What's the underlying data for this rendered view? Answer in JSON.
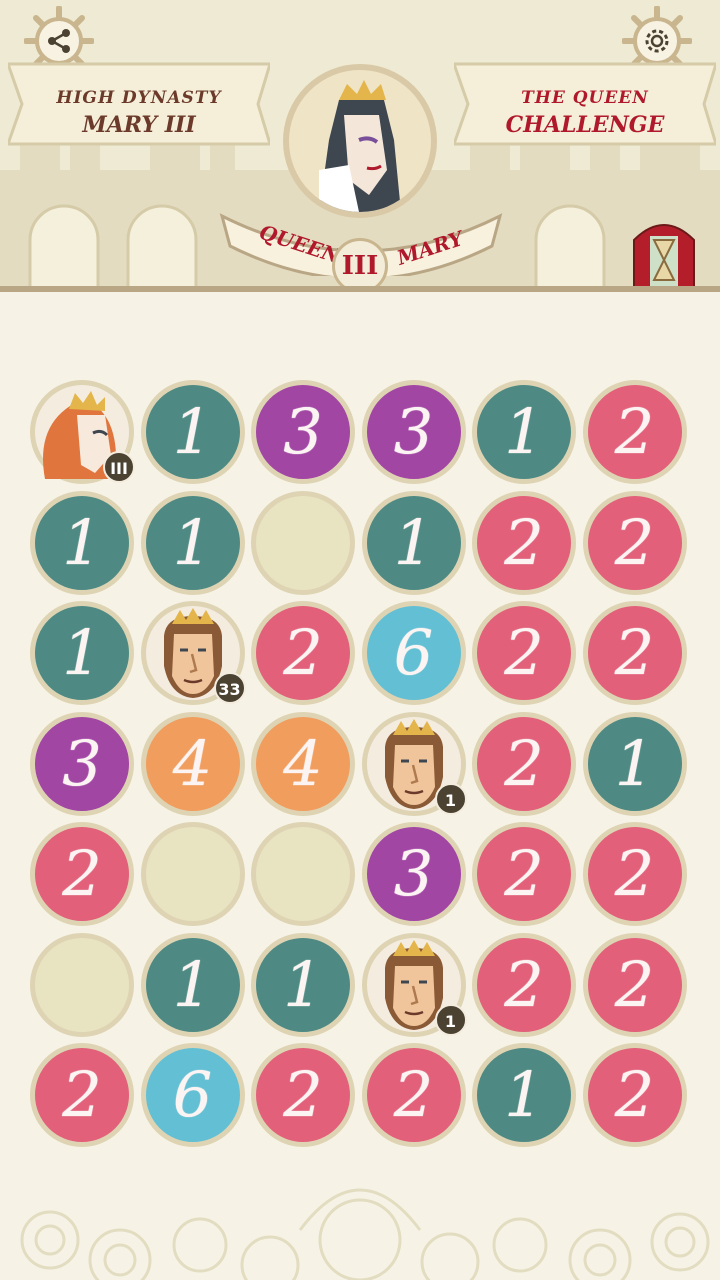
{
  "header": {
    "left_banner": {
      "line1": "HIGH DYNASTY",
      "line2": "MARY III"
    },
    "right_banner": {
      "line1": "THE QUEEN",
      "line2": "CHALLENGE"
    },
    "ribbon": {
      "left": "QUEEN",
      "right": "MARY"
    },
    "medal": "III",
    "share_icon": "share-icon",
    "settings_icon": "gear-icon",
    "timer_icon": "hourglass-icon"
  },
  "colors": {
    "1": "#4e8a83",
    "2": "#e2607a",
    "3": "#a246a4",
    "4": "#f19d5e",
    "6": "#63bfd3",
    "empty": "#e8e3c1"
  },
  "board": {
    "rows": [
      [
        {
          "type": "queen",
          "badge": "III"
        },
        {
          "type": "num",
          "value": "1"
        },
        {
          "type": "num",
          "value": "3"
        },
        {
          "type": "num",
          "value": "3"
        },
        {
          "type": "num",
          "value": "1"
        },
        {
          "type": "num",
          "value": "2"
        }
      ],
      [
        {
          "type": "num",
          "value": "1"
        },
        {
          "type": "num",
          "value": "1"
        },
        {
          "type": "empty"
        },
        {
          "type": "num",
          "value": "1"
        },
        {
          "type": "num",
          "value": "2"
        },
        {
          "type": "num",
          "value": "2"
        }
      ],
      [
        {
          "type": "num",
          "value": "1"
        },
        {
          "type": "king",
          "badge": "33"
        },
        {
          "type": "num",
          "value": "2"
        },
        {
          "type": "num",
          "value": "6"
        },
        {
          "type": "num",
          "value": "2"
        },
        {
          "type": "num",
          "value": "2"
        }
      ],
      [
        {
          "type": "num",
          "value": "3"
        },
        {
          "type": "num",
          "value": "4"
        },
        {
          "type": "num",
          "value": "4"
        },
        {
          "type": "king",
          "badge": "1"
        },
        {
          "type": "num",
          "value": "2"
        },
        {
          "type": "num",
          "value": "1"
        }
      ],
      [
        {
          "type": "num",
          "value": "2"
        },
        {
          "type": "empty"
        },
        {
          "type": "empty"
        },
        {
          "type": "num",
          "value": "3"
        },
        {
          "type": "num",
          "value": "2"
        },
        {
          "type": "num",
          "value": "2"
        }
      ],
      [
        {
          "type": "empty"
        },
        {
          "type": "num",
          "value": "1"
        },
        {
          "type": "num",
          "value": "1"
        },
        {
          "type": "king",
          "badge": "1"
        },
        {
          "type": "num",
          "value": "2"
        },
        {
          "type": "num",
          "value": "2"
        }
      ],
      [
        {
          "type": "num",
          "value": "2"
        },
        {
          "type": "num",
          "value": "6"
        },
        {
          "type": "num",
          "value": "2"
        },
        {
          "type": "num",
          "value": "2"
        },
        {
          "type": "num",
          "value": "1"
        },
        {
          "type": "num",
          "value": "2"
        }
      ]
    ]
  }
}
